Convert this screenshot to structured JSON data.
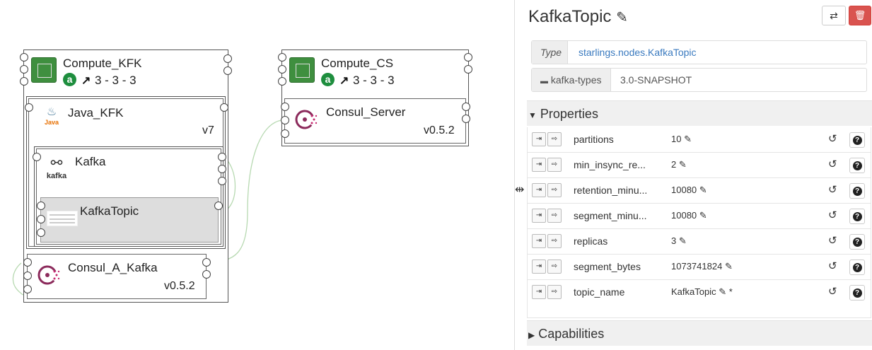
{
  "topology": {
    "compute_kfk": {
      "title": "Compute_KFK",
      "status_icon": "a",
      "instances": "3 - 3 - 3"
    },
    "compute_cs": {
      "title": "Compute_CS",
      "status_icon": "a",
      "instances": "3 - 3 - 3"
    },
    "java_kfk": {
      "title": "Java_KFK",
      "version": "v7",
      "logo_text": "Java"
    },
    "kafka": {
      "title": "Kafka",
      "logo_text": "kafka"
    },
    "kafka_topic": {
      "title": "KafkaTopic"
    },
    "consul_a_kafka": {
      "title": "Consul_A_Kafka",
      "version": "v0.5.2"
    },
    "consul_server": {
      "title": "Consul_Server",
      "version": "v0.5.2"
    }
  },
  "details": {
    "title": "KafkaTopic",
    "edit_icon": "edit-icon",
    "type_label": "Type",
    "type_value": "starlings.nodes.KafkaTopic",
    "archive_label": "kafka-types",
    "archive_version": "3.0-SNAPSHOT",
    "properties_label": "Properties",
    "capabilities_label": "Capabilities",
    "properties": [
      {
        "name": "partitions",
        "value": "10",
        "required": ""
      },
      {
        "name": "min_insync_re...",
        "value": "2",
        "required": ""
      },
      {
        "name": "retention_minu...",
        "value": "10080",
        "required": ""
      },
      {
        "name": "segment_minu...",
        "value": "10080",
        "required": ""
      },
      {
        "name": "replicas",
        "value": "3",
        "required": ""
      },
      {
        "name": "segment_bytes",
        "value": "1073741824",
        "required": ""
      },
      {
        "name": "topic_name",
        "value": "KafkaTopic",
        "required": "*"
      }
    ]
  },
  "colors": {
    "accent_link": "#3a7abf",
    "delete": "#d9534f",
    "status_green": "#1e8e3e"
  }
}
